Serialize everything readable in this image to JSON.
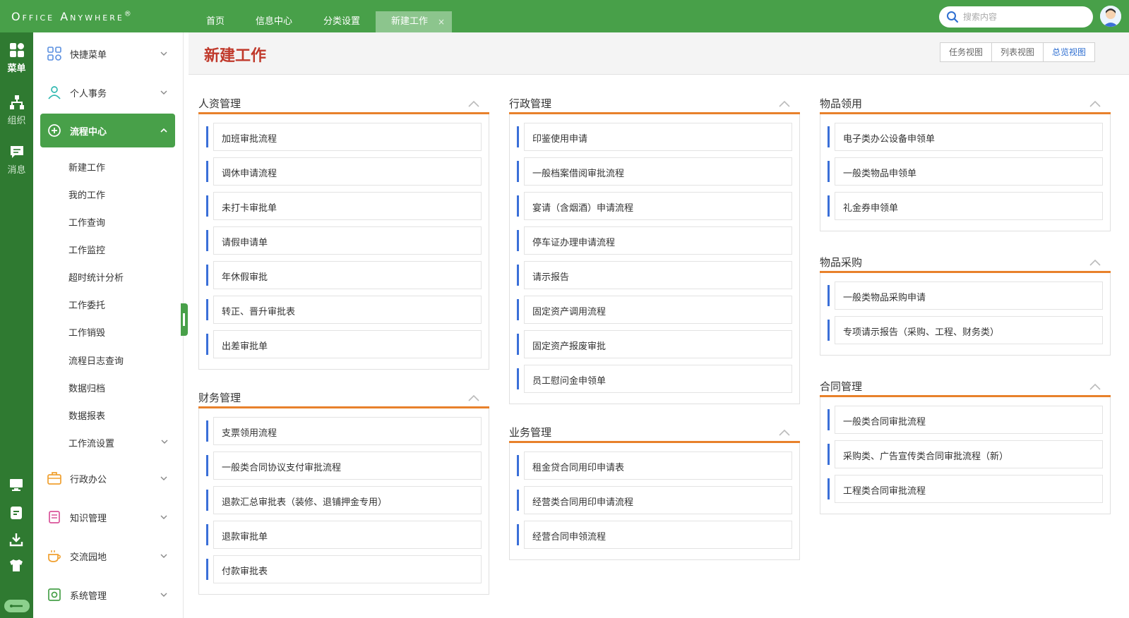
{
  "app": {
    "logo_text": "Office Anywhere",
    "logo_mark": "®"
  },
  "topnav": {
    "tabs": [
      {
        "label": "首页"
      },
      {
        "label": "信息中心"
      },
      {
        "label": "分类设置"
      },
      {
        "label": "新建工作",
        "active": true,
        "close": "×"
      }
    ],
    "search_placeholder": "搜索内容"
  },
  "rail": {
    "items": [
      {
        "label": "菜单",
        "icon": "grid-icon",
        "active": true
      },
      {
        "label": "组织",
        "icon": "org-icon"
      },
      {
        "label": "消息",
        "icon": "chat-icon"
      }
    ],
    "bottom_icons": [
      "monitor-icon",
      "note-icon",
      "download-icon",
      "shirt-icon",
      "toggle-icon"
    ]
  },
  "sidebar": {
    "groups": [
      {
        "label": "快捷菜单",
        "icon": "shortcut-icon"
      },
      {
        "label": "个人事务",
        "icon": "person-icon"
      },
      {
        "label": "流程中心",
        "icon": "workflow-icon",
        "active": true
      },
      {
        "label": "行政办公",
        "icon": "briefcase-icon"
      },
      {
        "label": "知识管理",
        "icon": "book-icon"
      },
      {
        "label": "交流园地",
        "icon": "coffee-icon"
      },
      {
        "label": "系统管理",
        "icon": "settings-icon"
      }
    ],
    "sub_items": [
      {
        "label": "新建工作"
      },
      {
        "label": "我的工作"
      },
      {
        "label": "工作查询"
      },
      {
        "label": "工作监控"
      },
      {
        "label": "超时统计分析"
      },
      {
        "label": "工作委托"
      },
      {
        "label": "工作销毁"
      },
      {
        "label": "流程日志查询"
      },
      {
        "label": "数据归档"
      },
      {
        "label": "数据报表"
      },
      {
        "label": "工作流设置"
      }
    ]
  },
  "main": {
    "title": "新建工作",
    "views": [
      {
        "label": "任务视图"
      },
      {
        "label": "列表视图"
      },
      {
        "label": "总览视图",
        "active": true
      }
    ],
    "sections": [
      {
        "title": "人资管理",
        "items": [
          "加班审批流程",
          "调休申请流程",
          "未打卡审批单",
          "请假申请单",
          "年休假审批",
          "转正、晋升审批表",
          "出差审批单"
        ]
      },
      {
        "title": "财务管理",
        "items": [
          "支票领用流程",
          "一般类合同协议支付审批流程",
          "退款汇总审批表（装修、退铺押金专用）",
          "退款审批单",
          "付款审批表"
        ]
      },
      {
        "title": "行政管理",
        "items": [
          "印鉴使用申请",
          "一般档案借阅审批流程",
          "宴请（含烟酒）申请流程",
          "停车证办理申请流程",
          "请示报告",
          "固定资产调用流程",
          "固定资产报废审批",
          "员工慰问金申领单"
        ]
      },
      {
        "title": "业务管理",
        "items": [
          "租金贷合同用印申请表",
          "经营类合同用印申请流程",
          "经营合同申领流程"
        ]
      },
      {
        "title": "物品领用",
        "items": [
          "电子类办公设备申领单",
          "一般类物品申领单",
          "礼金券申领单"
        ]
      },
      {
        "title": "物品采购",
        "items": [
          "一般类物品采购申请",
          "专项请示报告（采购、工程、财务类）"
        ]
      },
      {
        "title": "合同管理",
        "items": [
          "一般类合同审批流程",
          "采购类、广告宣传类合同审批流程（新）",
          "工程类合同审批流程"
        ]
      }
    ]
  },
  "colors": {
    "brand_green": "#48a049",
    "rail_green": "#2f7a31",
    "accent_orange": "#e8812b",
    "title_red": "#c0392b",
    "item_bar_blue": "#3a6fd8"
  }
}
